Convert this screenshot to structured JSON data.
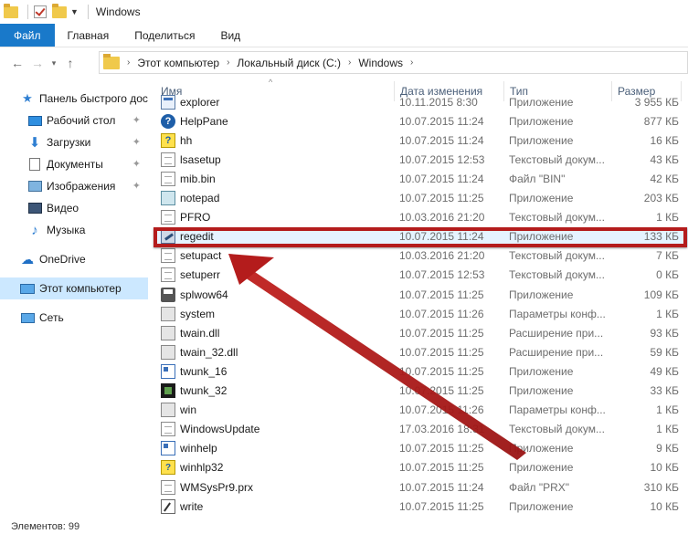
{
  "window": {
    "title": "Windows"
  },
  "ribbon": {
    "tabs": [
      "Файл",
      "Главная",
      "Поделиться",
      "Вид"
    ]
  },
  "address": {
    "crumbs": [
      "Этот компьютер",
      "Локальный диск (C:)",
      "Windows"
    ]
  },
  "sidebar": {
    "items": [
      {
        "label": "Панель быстрого доступа",
        "icon": "star-icon"
      },
      {
        "label": "Рабочий стол",
        "icon": "desktop-icon"
      },
      {
        "label": "Загрузки",
        "icon": "download-icon"
      },
      {
        "label": "Документы",
        "icon": "documents-icon"
      },
      {
        "label": "Изображения",
        "icon": "pictures-icon"
      },
      {
        "label": "Видео",
        "icon": "video-icon"
      },
      {
        "label": "Музыка",
        "icon": "music-icon"
      },
      {
        "label": "OneDrive",
        "icon": "cloud-icon"
      },
      {
        "label": "Этот компьютер",
        "icon": "computer-icon"
      },
      {
        "label": "Сеть",
        "icon": "network-icon"
      }
    ]
  },
  "columns": {
    "name": "Имя",
    "date": "Дата изменения",
    "type": "Тип",
    "size": "Размер"
  },
  "files": [
    {
      "name": "explorer",
      "date": "10.11.2015 8:30",
      "type": "Приложение",
      "size": "3 955 КБ",
      "icon": "exe"
    },
    {
      "name": "HelpPane",
      "date": "10.07.2015 11:24",
      "type": "Приложение",
      "size": "877 КБ",
      "icon": "help"
    },
    {
      "name": "hh",
      "date": "10.07.2015 11:24",
      "type": "Приложение",
      "size": "16 КБ",
      "icon": "hh"
    },
    {
      "name": "lsasetup",
      "date": "10.07.2015 12:53",
      "type": "Текстовый докум...",
      "size": "43 КБ",
      "icon": "doc"
    },
    {
      "name": "mib.bin",
      "date": "10.07.2015 11:24",
      "type": "Файл \"BIN\"",
      "size": "42 КБ",
      "icon": "doc"
    },
    {
      "name": "notepad",
      "date": "10.07.2015 11:25",
      "type": "Приложение",
      "size": "203 КБ",
      "icon": "note"
    },
    {
      "name": "PFRO",
      "date": "10.03.2016 21:20",
      "type": "Текстовый докум...",
      "size": "1 КБ",
      "icon": "doc"
    },
    {
      "name": "regedit",
      "date": "10.07.2015 11:24",
      "type": "Приложение",
      "size": "133 КБ",
      "icon": "reg"
    },
    {
      "name": "setupact",
      "date": "10.03.2016 21:20",
      "type": "Текстовый докум...",
      "size": "7 КБ",
      "icon": "doc"
    },
    {
      "name": "setuperr",
      "date": "10.07.2015 12:53",
      "type": "Текстовый докум...",
      "size": "0 КБ",
      "icon": "doc"
    },
    {
      "name": "splwow64",
      "date": "10.07.2015 11:25",
      "type": "Приложение",
      "size": "109 КБ",
      "icon": "printer"
    },
    {
      "name": "system",
      "date": "10.07.2015 11:26",
      "type": "Параметры конф...",
      "size": "1 КБ",
      "icon": "cog"
    },
    {
      "name": "twain.dll",
      "date": "10.07.2015 11:25",
      "type": "Расширение при...",
      "size": "93 КБ",
      "icon": "cog"
    },
    {
      "name": "twain_32.dll",
      "date": "10.07.2015 11:25",
      "type": "Расширение при...",
      "size": "59 КБ",
      "icon": "cog"
    },
    {
      "name": "twunk_16",
      "date": "10.07.2015 11:25",
      "type": "Приложение",
      "size": "49 КБ",
      "icon": "win16"
    },
    {
      "name": "twunk_32",
      "date": "10.07.2015 11:25",
      "type": "Приложение",
      "size": "33 КБ",
      "icon": "chip"
    },
    {
      "name": "win",
      "date": "10.07.2015 11:26",
      "type": "Параметры конф...",
      "size": "1 КБ",
      "icon": "cog"
    },
    {
      "name": "WindowsUpdate",
      "date": "17.03.2016 18:31",
      "type": "Текстовый докум...",
      "size": "1 КБ",
      "icon": "doc"
    },
    {
      "name": "winhelp",
      "date": "10.07.2015 11:25",
      "type": "Приложение",
      "size": "9 КБ",
      "icon": "win16"
    },
    {
      "name": "winhlp32",
      "date": "10.07.2015 11:25",
      "type": "Приложение",
      "size": "10 КБ",
      "icon": "qhelp"
    },
    {
      "name": "WMSysPr9.prx",
      "date": "10.07.2015 11:24",
      "type": "Файл \"PRX\"",
      "size": "310 КБ",
      "icon": "doc"
    },
    {
      "name": "write",
      "date": "10.07.2015 11:25",
      "type": "Приложение",
      "size": "10 КБ",
      "icon": "wr"
    }
  ],
  "status": {
    "count": "Элементов: 99"
  },
  "colors": {
    "accent": "#1979ca",
    "highlight": "#b41c1c",
    "selected_row": "#e5f3ff"
  }
}
